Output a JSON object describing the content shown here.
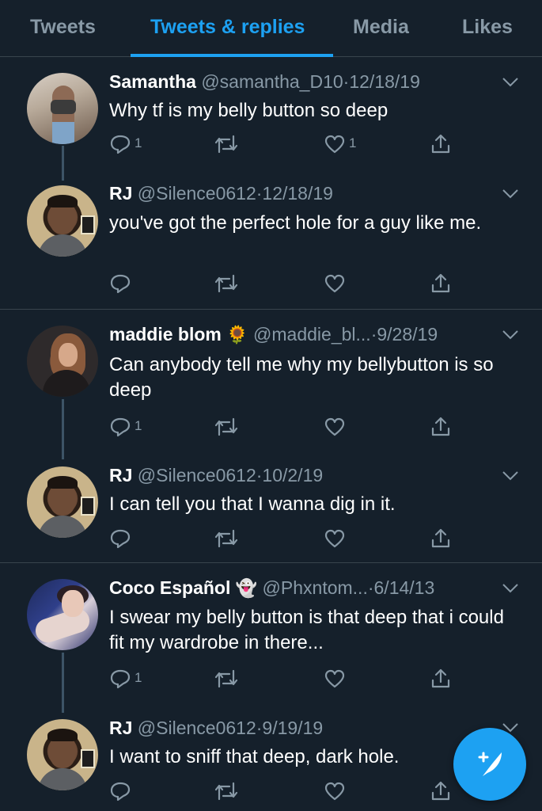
{
  "tabs": [
    {
      "label": "Tweets",
      "active": false
    },
    {
      "label": "Tweets & replies",
      "active": true
    },
    {
      "label": "Media",
      "active": false
    },
    {
      "label": "Likes",
      "active": false
    }
  ],
  "colors": {
    "background": "#15202b",
    "accent": "#1da1f2",
    "muted": "#8899a6",
    "divider": "#38444d"
  },
  "tweets": [
    {
      "name": "Samantha",
      "handle": "@samantha_D10",
      "date": "12/18/19",
      "text": "Why tf is my belly button so deep",
      "reply_count": "1",
      "like_count": "1"
    },
    {
      "name": "RJ",
      "handle": "@Silence0612",
      "date": "12/18/19",
      "text": "you've got the perfect hole for a guy like me.",
      "reply_count": "",
      "like_count": ""
    },
    {
      "name": "maddie blom",
      "name_emoji": "🌻",
      "handle": "@maddie_bl...",
      "date": "9/28/19",
      "text": "Can anybody tell me why my bellybutton is so deep",
      "reply_count": "1",
      "like_count": ""
    },
    {
      "name": "RJ",
      "handle": "@Silence0612",
      "date": "10/2/19",
      "text": "I can tell you that I wanna dig in it.",
      "reply_count": "",
      "like_count": ""
    },
    {
      "name": "Coco Español",
      "name_emoji": "👻",
      "handle": "@Phxntom...",
      "date": "6/14/13",
      "text": "I swear my belly button is that deep that i could fit my wardrobe in there...",
      "reply_count": "1",
      "like_count": ""
    },
    {
      "name": "RJ",
      "handle": "@Silence0612",
      "date": "9/19/19",
      "text": "I want to sniff that deep, dark hole.",
      "reply_count": "",
      "like_count": ""
    }
  ],
  "separator": "·",
  "icons": {
    "reply": "reply-icon",
    "retweet": "retweet-icon",
    "like": "like-icon",
    "share": "share-icon",
    "caret": "chevron-down-icon",
    "compose": "compose-tweet-icon"
  }
}
